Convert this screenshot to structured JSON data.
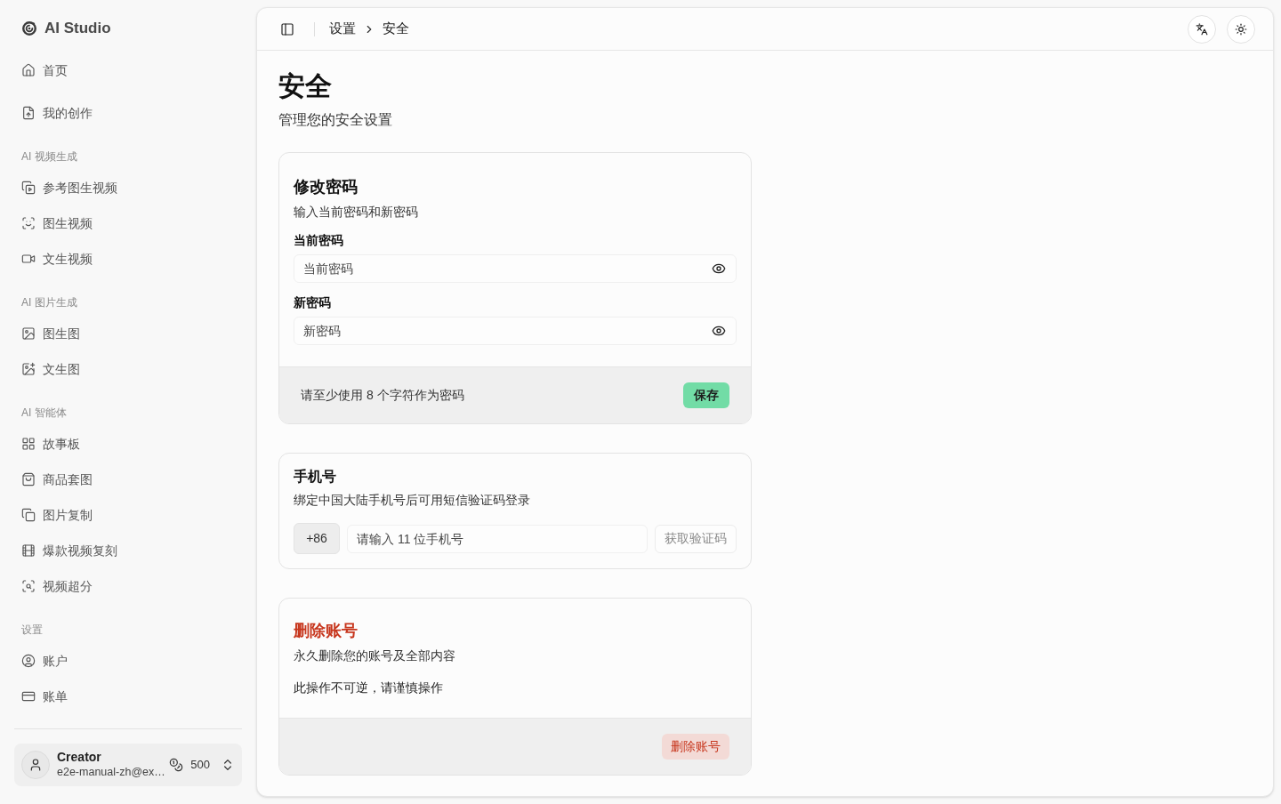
{
  "sidebar": {
    "brand": "AI Studio",
    "sections": [
      {
        "items": [
          {
            "label": "首页",
            "selected": false
          },
          {
            "label": "我的创作",
            "selected": false
          }
        ]
      },
      {
        "heading": "AI 视频生成",
        "items": [
          {
            "label": "参考图生视频",
            "selected": false
          },
          {
            "label": "图生视频",
            "selected": false
          },
          {
            "label": "文生视频",
            "selected": false
          }
        ]
      },
      {
        "heading": "AI 图片生成",
        "items": [
          {
            "label": "图生图",
            "selected": false
          },
          {
            "label": "文生图",
            "selected": false
          }
        ]
      },
      {
        "heading": "AI 智能体",
        "items": [
          {
            "label": "故事板",
            "selected": false
          },
          {
            "label": "商品套图",
            "selected": false
          },
          {
            "label": "图片复制",
            "selected": false
          },
          {
            "label": "爆款视频复刻",
            "selected": false
          },
          {
            "label": "视频超分",
            "selected": false
          }
        ]
      },
      {
        "heading": "设置",
        "items": [
          {
            "label": "账户",
            "selected": false
          },
          {
            "label": "账单",
            "selected": false
          }
        ]
      }
    ],
    "user": {
      "name": "Creator",
      "email": "e2e-manual-zh@ex…",
      "credits": "500"
    }
  },
  "header": {
    "breadcrumb": [
      "设置",
      "安全"
    ]
  },
  "page": {
    "title": "安全",
    "subtitle": "管理您的安全设置"
  },
  "cards": [
    {
      "kind": "password",
      "title": "修改密码",
      "description": "输入当前密码和新密码",
      "fields": [
        {
          "label": "当前密码",
          "placeholder": "当前密码"
        },
        {
          "label": "新密码",
          "placeholder": "新密码"
        }
      ],
      "footer_note": "请至少使用 8 个字符作为密码",
      "button": {
        "label": "保存",
        "disabled": false
      }
    },
    {
      "kind": "phone",
      "title": "手机号",
      "description": "绑定中国大陆手机号后可用短信验证码登录",
      "country_code": "+86",
      "phone": {
        "placeholder": "请输入 11 位手机号"
      },
      "button": {
        "label": "获取验证码",
        "disabled": true
      }
    },
    {
      "kind": "danger",
      "title": "删除账号",
      "description": "永久删除您的账号及全部内容",
      "warning": "此操作不可逆，请谨慎操作",
      "button": {
        "label": "删除账号"
      }
    }
  ]
}
